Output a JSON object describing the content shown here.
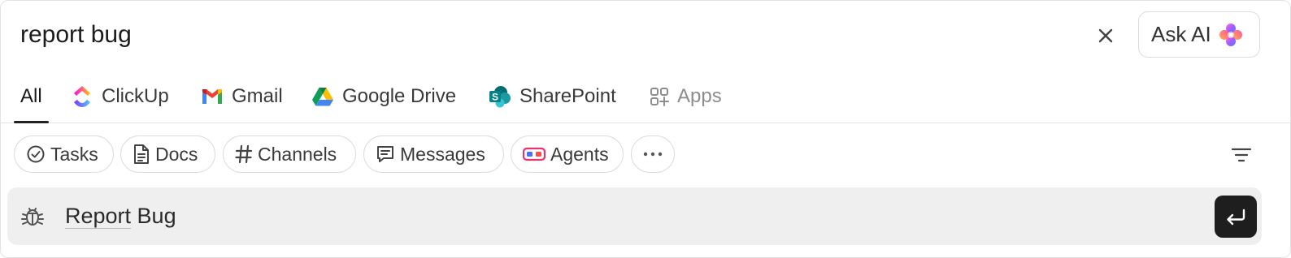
{
  "search": {
    "query": "report bug"
  },
  "ask_ai": {
    "label": "Ask AI"
  },
  "tabs": [
    {
      "label": "All",
      "icon": "none",
      "active": true
    },
    {
      "label": "ClickUp",
      "icon": "clickup-icon"
    },
    {
      "label": "Gmail",
      "icon": "gmail-icon"
    },
    {
      "label": "Google Drive",
      "icon": "google-drive-icon"
    },
    {
      "label": "SharePoint",
      "icon": "sharepoint-icon"
    },
    {
      "label": "Apps",
      "icon": "apps-icon"
    }
  ],
  "filters": [
    {
      "label": "Tasks",
      "icon": "check-circle-icon"
    },
    {
      "label": "Docs",
      "icon": "doc-icon"
    },
    {
      "label": "Channels",
      "icon": "hash-icon"
    },
    {
      "label": "Messages",
      "icon": "message-icon"
    },
    {
      "label": "Agents",
      "icon": "agents-icon"
    }
  ],
  "result": {
    "label_part1": "Report",
    "label_part2": " Bug",
    "icon": "bug-icon"
  },
  "colors": {
    "active_tab_underline": "#222222",
    "result_bg": "#efefef",
    "enter_bg": "#1e1e1e"
  }
}
